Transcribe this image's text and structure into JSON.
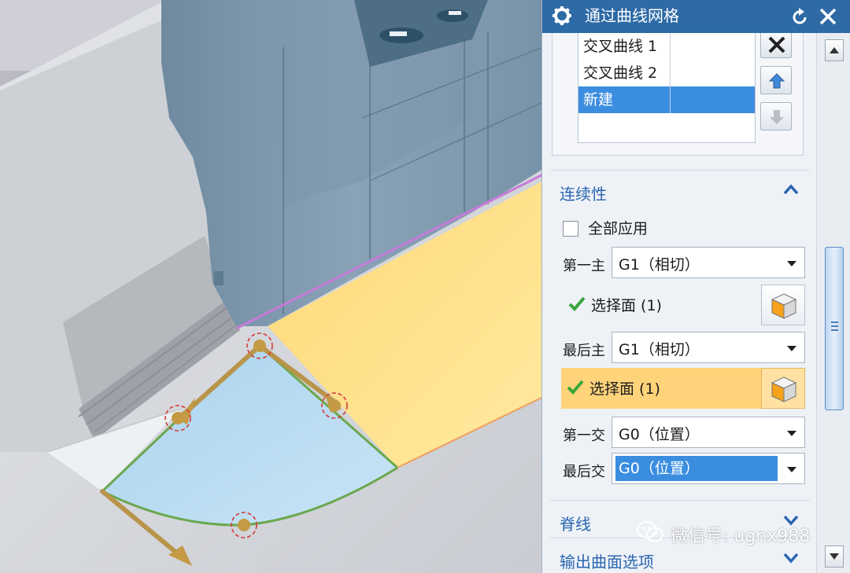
{
  "dialog": {
    "title": "通过曲线网格",
    "colors": {
      "titlebar": "#2d6aa6",
      "accent_blue": "#2a66b0",
      "selection": "#3b8de0",
      "highlight": "#ffd37a"
    }
  },
  "curve_list": {
    "rows": [
      {
        "name": "交叉曲线 1",
        "selected": false
      },
      {
        "name": "交叉曲线 2",
        "selected": false
      },
      {
        "name": "新建",
        "selected": true
      }
    ]
  },
  "continuity": {
    "section_label": "连续性",
    "expanded": true,
    "apply_all_label": "全部应用",
    "apply_all_checked": false,
    "rows": [
      {
        "label": "第一主",
        "value": "G1（相切）"
      },
      {
        "select_face_label": "选择面 (1)"
      },
      {
        "label": "最后主",
        "value": "G1（相切）"
      },
      {
        "select_face_label": "选择面 (1)"
      },
      {
        "label": "第一交",
        "value": "G0（位置）"
      },
      {
        "label": "最后交",
        "value": "G0（位置）"
      }
    ]
  },
  "spine": {
    "section_label": "脊线",
    "expanded": false
  },
  "output_options": {
    "section_label": "输出曲面选项",
    "expanded": false
  },
  "watermark": {
    "text": "微信号: ugnx988"
  }
}
